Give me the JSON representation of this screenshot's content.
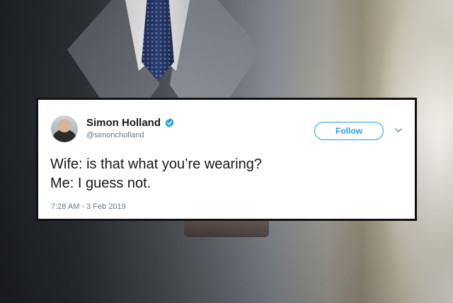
{
  "tweet": {
    "display_name": "Simon Holland",
    "handle": "@simoncholland",
    "follow_label": "Follow",
    "text_lines": [
      "Wife: is that what you’re wearing?",
      "Me: I guess not."
    ],
    "timestamp": "7:28 AM - 3 Feb 2019",
    "verified": true
  },
  "icons": {
    "verified": "verified-badge-icon",
    "menu": "chevron-down-icon",
    "avatar": "profile-avatar"
  },
  "colors": {
    "accent": "#1da1f2",
    "text": "#14171a",
    "secondary_text": "#657786",
    "card_border": "#111111"
  }
}
